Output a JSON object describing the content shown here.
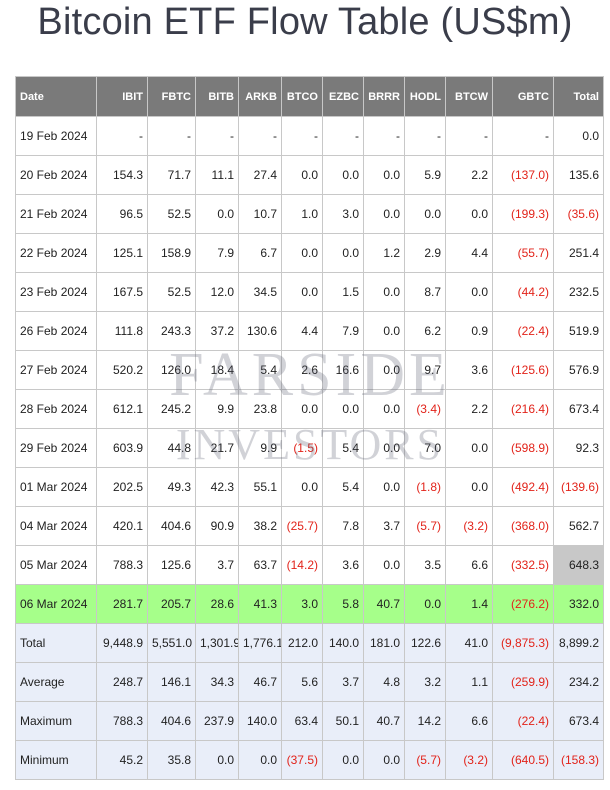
{
  "page": {
    "title": "Bitcoin ETF Flow Table (US$m)"
  },
  "watermark": {
    "line1": "FARSIDE",
    "line2": "INVESTORS"
  },
  "table": {
    "headers": [
      "Date",
      "IBIT",
      "FBTC",
      "BITB",
      "ARKB",
      "BTCO",
      "EZBC",
      "BRRR",
      "HODL",
      "BTCW",
      "GBTC",
      "Total"
    ],
    "rows": [
      [
        "19 Feb 2024",
        "-",
        "-",
        "-",
        "-",
        "-",
        "-",
        "-",
        "-",
        "-",
        "-",
        "0.0"
      ],
      [
        "20 Feb 2024",
        "154.3",
        "71.7",
        "11.1",
        "27.4",
        "0.0",
        "0.0",
        "0.0",
        "5.9",
        "2.2",
        "(137.0)",
        "135.6"
      ],
      [
        "21 Feb 2024",
        "96.5",
        "52.5",
        "0.0",
        "10.7",
        "1.0",
        "3.0",
        "0.0",
        "0.0",
        "0.0",
        "(199.3)",
        "(35.6)"
      ],
      [
        "22 Feb 2024",
        "125.1",
        "158.9",
        "7.9",
        "6.7",
        "0.0",
        "0.0",
        "1.2",
        "2.9",
        "4.4",
        "(55.7)",
        "251.4"
      ],
      [
        "23 Feb 2024",
        "167.5",
        "52.5",
        "12.0",
        "34.5",
        "0.0",
        "1.5",
        "0.0",
        "8.7",
        "0.0",
        "(44.2)",
        "232.5"
      ],
      [
        "26 Feb 2024",
        "111.8",
        "243.3",
        "37.2",
        "130.6",
        "4.4",
        "7.9",
        "0.0",
        "6.2",
        "0.9",
        "(22.4)",
        "519.9"
      ],
      [
        "27 Feb 2024",
        "520.2",
        "126.0",
        "18.4",
        "5.4",
        "2.6",
        "16.6",
        "0.0",
        "9.7",
        "3.6",
        "(125.6)",
        "576.9"
      ],
      [
        "28 Feb 2024",
        "612.1",
        "245.2",
        "9.9",
        "23.8",
        "0.0",
        "0.0",
        "0.0",
        "(3.4)",
        "2.2",
        "(216.4)",
        "673.4"
      ],
      [
        "29 Feb 2024",
        "603.9",
        "44.8",
        "21.7",
        "9.9",
        "(1.5)",
        "5.4",
        "0.0",
        "7.0",
        "0.0",
        "(598.9)",
        "92.3"
      ],
      [
        "01 Mar 2024",
        "202.5",
        "49.3",
        "42.3",
        "55.1",
        "0.0",
        "5.4",
        "0.0",
        "(1.8)",
        "0.0",
        "(492.4)",
        "(139.6)"
      ],
      [
        "04 Mar 2024",
        "420.1",
        "404.6",
        "90.9",
        "38.2",
        "(25.7)",
        "7.8",
        "3.7",
        "(5.7)",
        "(3.2)",
        "(368.0)",
        "562.7"
      ],
      [
        "05 Mar 2024",
        "788.3",
        "125.6",
        "3.7",
        "63.7",
        "(14.2)",
        "3.6",
        "0.0",
        "3.5",
        "6.6",
        "(332.5)",
        "648.3"
      ],
      [
        "06 Mar 2024",
        "281.7",
        "205.7",
        "28.6",
        "41.3",
        "3.0",
        "5.8",
        "40.7",
        "0.0",
        "1.4",
        "(276.2)",
        "332.0"
      ]
    ],
    "summary": [
      [
        "Total",
        "9,448.9",
        "5,551.0",
        "1,301.9",
        "1,776.1",
        "212.0",
        "140.0",
        "181.0",
        "122.6",
        "41.0",
        "(9,875.3)",
        "8,899.2"
      ],
      [
        "Average",
        "248.7",
        "146.1",
        "34.3",
        "46.7",
        "5.6",
        "3.7",
        "4.8",
        "3.2",
        "1.1",
        "(259.9)",
        "234.2"
      ],
      [
        "Maximum",
        "788.3",
        "404.6",
        "237.9",
        "140.0",
        "63.4",
        "50.1",
        "40.7",
        "14.2",
        "6.6",
        "(22.4)",
        "673.4"
      ],
      [
        "Minimum",
        "45.2",
        "35.8",
        "0.0",
        "0.0",
        "(37.5)",
        "0.0",
        "0.0",
        "(5.7)",
        "(3.2)",
        "(640.5)",
        "(158.3)"
      ]
    ],
    "highlight_row_index": 12,
    "boxed_cell": {
      "row": 11,
      "col": 11
    },
    "colors": {
      "header_bg": "#7a7a7a",
      "highlight_bg": "#a6ff8a",
      "summary_bg": "#e9eef9",
      "negative": "#e2231a"
    }
  }
}
